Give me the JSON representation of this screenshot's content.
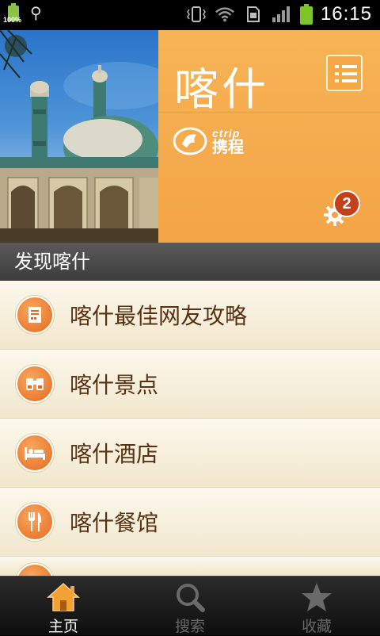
{
  "status_bar": {
    "battery_small": "100%",
    "time": "16:15"
  },
  "header": {
    "city_title": "喀什",
    "logo_en": "ctrip",
    "logo_cn": "携程",
    "notification_count": "2"
  },
  "section": {
    "title": "发现喀什"
  },
  "list": {
    "items": [
      {
        "label": "喀什最佳网友攻略",
        "icon": "guide-book-icon"
      },
      {
        "label": "喀什景点",
        "icon": "binoculars-icon"
      },
      {
        "label": "喀什酒店",
        "icon": "bed-icon"
      },
      {
        "label": "喀什餐馆",
        "icon": "fork-knife-icon"
      }
    ]
  },
  "tabs": [
    {
      "label": "主页",
      "icon": "home-icon",
      "active": true
    },
    {
      "label": "搜索",
      "icon": "search-icon",
      "active": false
    },
    {
      "label": "收藏",
      "icon": "star-icon",
      "active": false
    }
  ],
  "colors": {
    "accent_orange": "#f3a446",
    "list_text": "#5a3012",
    "badge": "#c2401a"
  }
}
